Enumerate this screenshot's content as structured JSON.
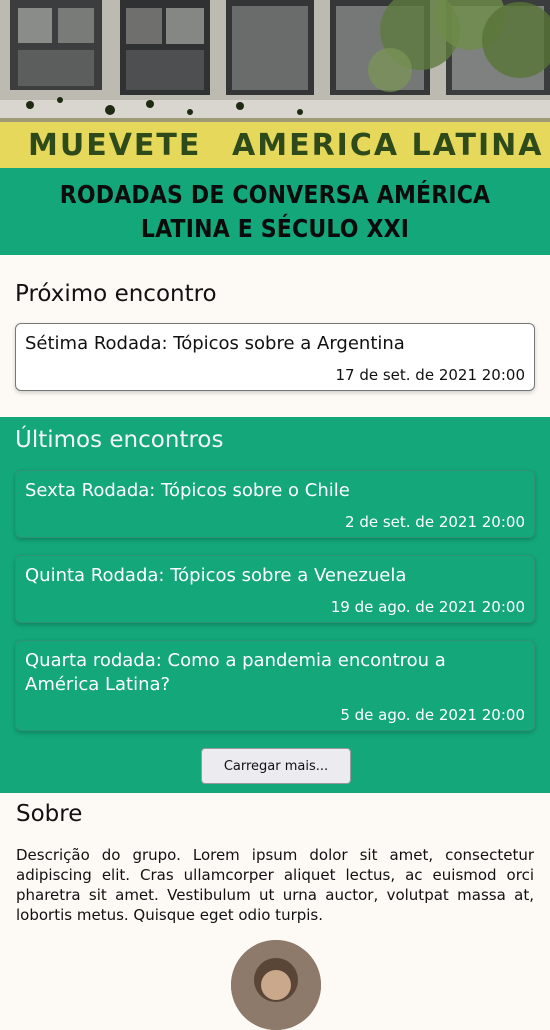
{
  "banner": {
    "graffiti_left": "MUEVETE",
    "graffiti_right": "AMERICA LATINA"
  },
  "title": "RODADAS DE CONVERSA AMÉRICA LATINA E SÉCULO XXI",
  "next": {
    "heading": "Próximo encontro",
    "event": {
      "title": "Sétima Rodada: Tópicos sobre a Argentina",
      "date": "17 de set. de 2021 20:00"
    }
  },
  "last": {
    "heading": "Últimos encontros",
    "events": [
      {
        "title": "Sexta Rodada: Tópicos sobre o Chile",
        "date": "2 de set. de 2021 20:00"
      },
      {
        "title": "Quinta Rodada: Tópicos sobre a Venezuela",
        "date": "19 de ago. de 2021 20:00"
      },
      {
        "title": "Quarta rodada: Como a pandemia encontrou a América Latina?",
        "date": "5 de ago. de 2021 20:00"
      }
    ],
    "load_more_label": "Carregar mais..."
  },
  "about": {
    "heading": "Sobre",
    "description": "Descrição do grupo. Lorem ipsum dolor sit amet, consectetur adipiscing elit. Cras ullamcorper aliquet lectus, ac euismod orci pharetra sit amet. Vestibulum ut urna auctor, volutpat massa at, lobortis metus. Quisque eget odio turpis."
  },
  "colors": {
    "brand_green": "#13a77a",
    "page_background": "#fdfaf6"
  }
}
